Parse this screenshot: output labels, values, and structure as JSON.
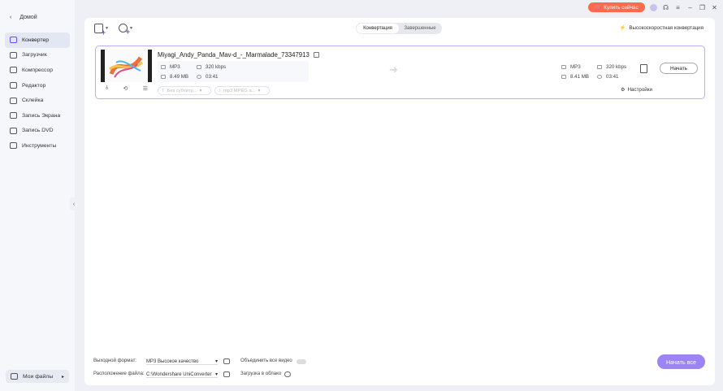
{
  "sidebar": {
    "home_label": "Домой",
    "items": [
      {
        "label": "Конвертер",
        "active": true
      },
      {
        "label": "Загрузчик"
      },
      {
        "label": "Компрессор"
      },
      {
        "label": "Редактор"
      },
      {
        "label": "Склейка"
      },
      {
        "label": "Запись Экрана"
      },
      {
        "label": "Запись DVD"
      },
      {
        "label": "Инструменты"
      }
    ],
    "my_files_label": "Мои файлы"
  },
  "titlebar": {
    "buy_label": "Купить сейчас",
    "accent_color": "#ff6a4d"
  },
  "toolbar": {
    "tabs": [
      "Конвертация",
      "Завершенные"
    ],
    "active_tab": "Конвертация",
    "high_speed_label": "Высокоскоростная конвертация"
  },
  "file": {
    "name": "Miyagi_Andy_Panda_Mav-d_-_Marmalade_73347913",
    "source": {
      "format": "MP3",
      "size": "8.49 MB",
      "bitrate": "320 kbps",
      "duration": "03:41"
    },
    "target": {
      "format": "MP3",
      "size": "8.41 MB",
      "bitrate": "320 kbps",
      "duration": "03:41"
    },
    "start_label": "Начать",
    "subtitle_placeholder": "Без субтитр...",
    "audio_track": "mp3 MPEG a...",
    "settings_label": "Настройки"
  },
  "bottom": {
    "output_format_label": "Выходной формат:",
    "output_format_value": "MP3 Высокое качество",
    "merge_label": "Объединить все видео",
    "location_label": "Расположение файла:",
    "location_value": "C:\\Wondershare UniConverter",
    "upload_label": "Загрузка в облако",
    "start_all_label": "Начать все",
    "primary_color": "#9d84f5"
  }
}
